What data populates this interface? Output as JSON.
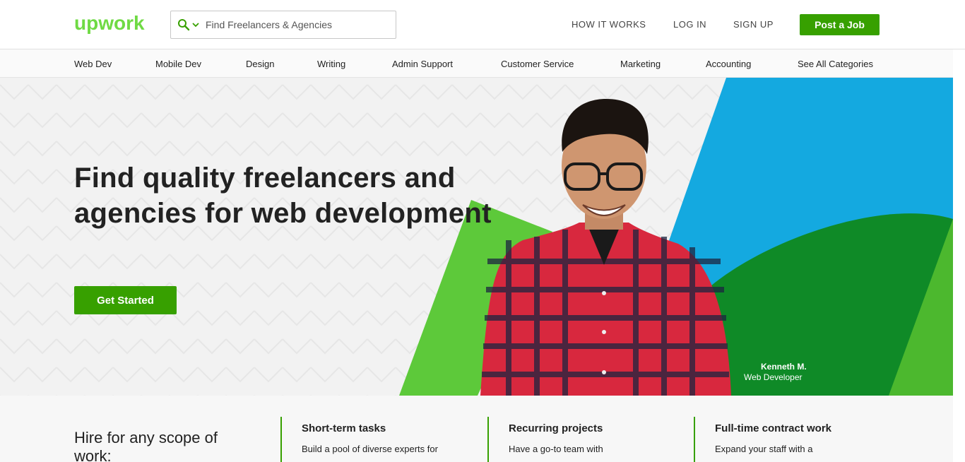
{
  "header": {
    "logo_text": "upwork",
    "search_placeholder": "Find Freelancers & Agencies",
    "nav": [
      "HOW IT WORKS",
      "LOG IN",
      "SIGN UP"
    ],
    "post_job": "Post a Job"
  },
  "categories": [
    "Web Dev",
    "Mobile Dev",
    "Design",
    "Writing",
    "Admin Support",
    "Customer Service",
    "Marketing",
    "Accounting",
    "See All Categories"
  ],
  "hero": {
    "headline": "Find quality freelancers and agencies for web development",
    "cta": "Get Started",
    "person_name": "Kenneth M.",
    "person_role": "Web Developer"
  },
  "scope": {
    "title": "Hire for any scope of work:",
    "cards": [
      {
        "title": "Short-term tasks",
        "text": "Build a pool of diverse experts for"
      },
      {
        "title": "Recurring projects",
        "text": "Have a go-to team with"
      },
      {
        "title": "Full-time contract work",
        "text": "Expand your staff with a"
      }
    ]
  },
  "colors": {
    "brand_green": "#37a000",
    "logo_green": "#6fda44",
    "hero_blue": "#14a9e0",
    "hero_dark_green": "#0f8a27",
    "hero_light_green": "#5dc93a"
  }
}
